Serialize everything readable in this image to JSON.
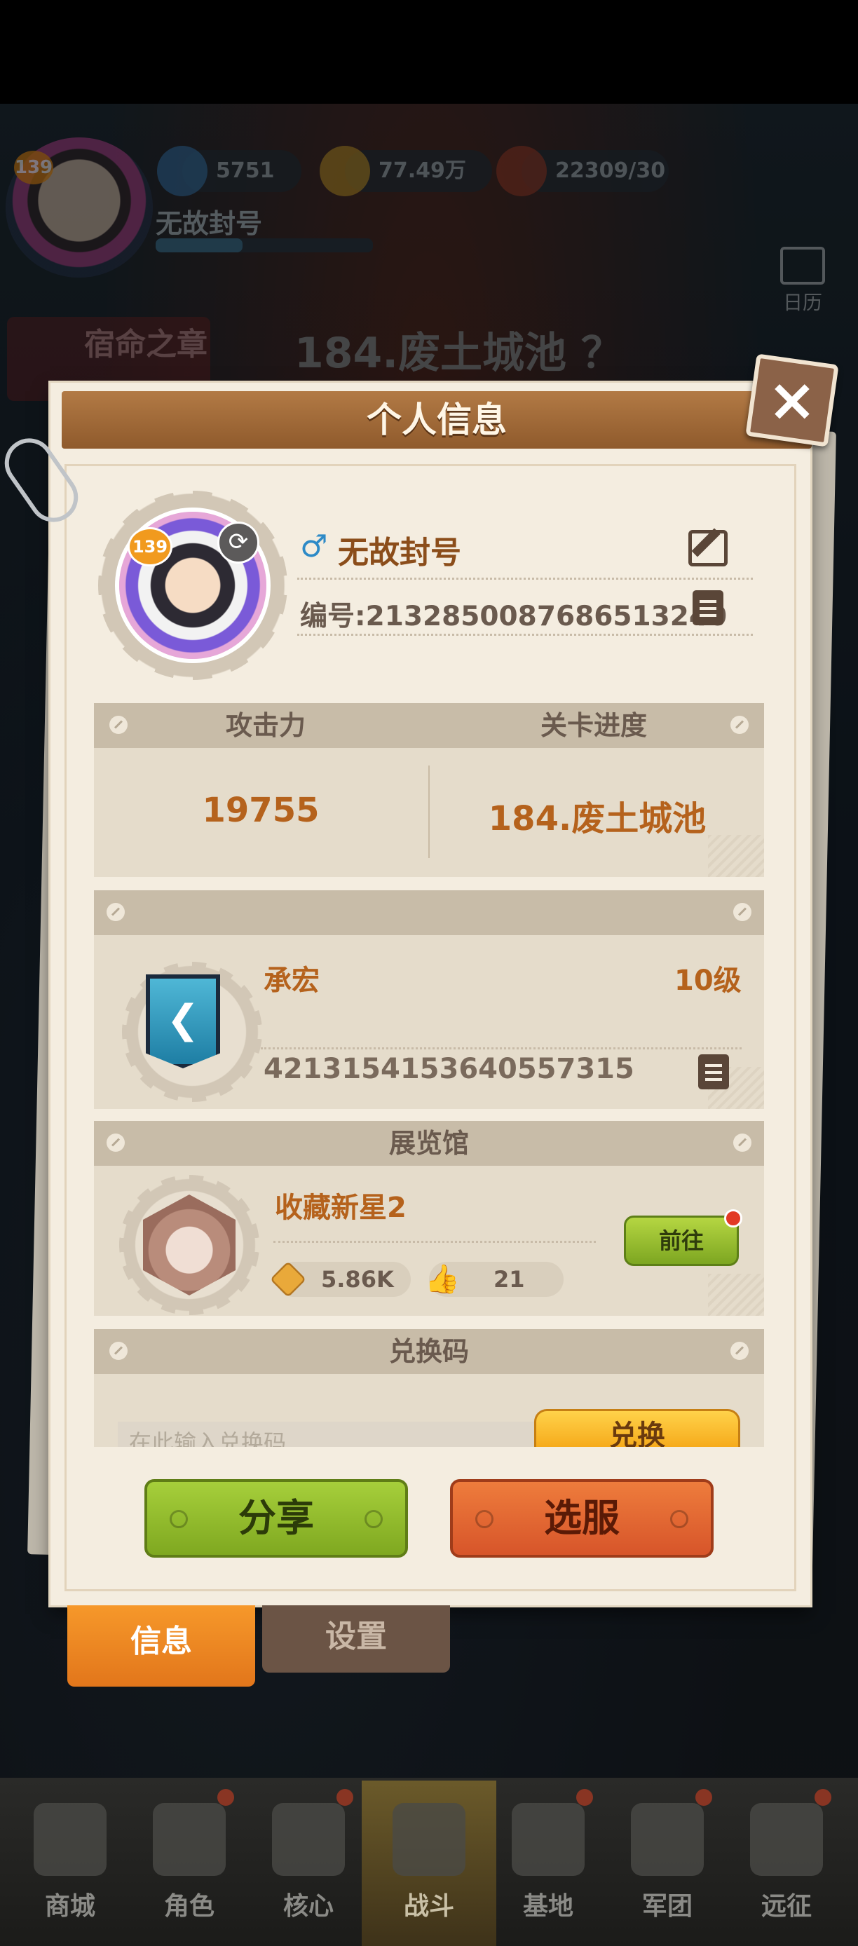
{
  "hud": {
    "player_level": "139",
    "player_name": "无故封号",
    "resources": [
      {
        "icon": "diamond-icon",
        "value": "5751"
      },
      {
        "icon": "coin-icon",
        "value": "77.49万"
      },
      {
        "icon": "stamina-icon",
        "value": "22309/30"
      }
    ],
    "calendar_label": "日历",
    "stage_title": "184.废土城池 ？",
    "side_event_label": "宿命之章"
  },
  "panel": {
    "title": "个人信息",
    "profile": {
      "level": "139",
      "gender_symbol": "♂",
      "name": "无故封号",
      "uid_label": "编号:213285008768651324​0",
      "uid_text": "编号:2132850087686513240"
    },
    "stats": {
      "attack_label": "攻击力",
      "attack_value": "19755",
      "progress_label": "关卡进度",
      "progress_value": "184.废土城池"
    },
    "guild": {
      "name": "承宏",
      "level": "10级",
      "id": "4213154153640557315"
    },
    "gallery": {
      "header": "展览馆",
      "title": "收藏新星2",
      "coins": "5.86K",
      "likes": "21",
      "goto_label": "前往"
    },
    "redeem": {
      "header": "兑换码",
      "placeholder": "在此输入兑换码",
      "button_label": "兑换"
    },
    "share_label": "分享",
    "server_label": "选服"
  },
  "tabs": [
    {
      "label": "信息",
      "active": true
    },
    {
      "label": "设置",
      "active": false
    }
  ],
  "nav": [
    {
      "label": "商城"
    },
    {
      "label": "角色"
    },
    {
      "label": "核心"
    },
    {
      "label": "战斗",
      "active": true
    },
    {
      "label": "基地"
    },
    {
      "label": "军团"
    },
    {
      "label": "远征"
    }
  ],
  "colors": {
    "accent_orange": "#f6982a",
    "title_brown": "#8f5a2c",
    "value_orange": "#b5621c",
    "green_button": "#7fa820",
    "orange_button": "#d7552a"
  }
}
